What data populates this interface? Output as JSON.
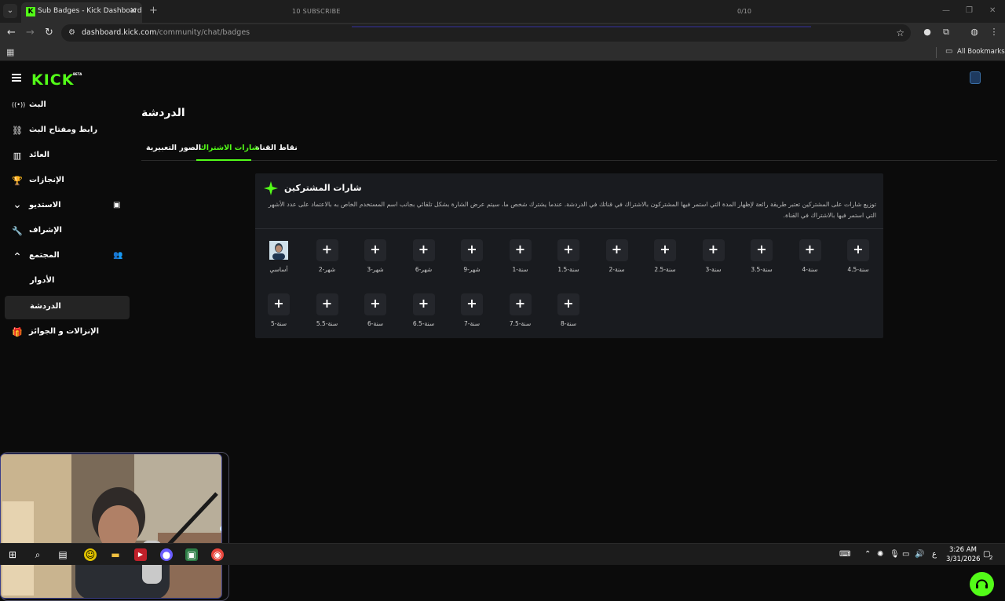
{
  "browser": {
    "tab_title": "Sub Badges - Kick Dashboard",
    "tab_favicon": "K",
    "new_tab_symbol": "+",
    "close_symbol": "✕",
    "url_domain": "dashboard.kick.com",
    "url_path": "/community/chat/badges",
    "bookmarks_label": "All Bookmarks"
  },
  "stream_overlay": {
    "subscribe_text": "10 SUBSCRIBE",
    "count_text": "0/10"
  },
  "app": {
    "logo": "KICK",
    "logo_badge": "BETA"
  },
  "sidebar": {
    "items": [
      {
        "label": "البث",
        "icon": "broadcast-icon",
        "glyph": "((•))"
      },
      {
        "label": "رابط ومفتاح البث",
        "icon": "link-icon",
        "glyph": "⛓"
      },
      {
        "label": "العائد",
        "icon": "revenue-chart-icon",
        "glyph": "▥"
      },
      {
        "label": "الإنجازات",
        "icon": "trophy-icon",
        "glyph": "🏆"
      },
      {
        "label": "الاستديو",
        "icon": "chevron-down-icon",
        "glyph": "⌄",
        "right_glyph": "▣"
      },
      {
        "label": "الإشراف",
        "icon": "wrench-icon",
        "glyph": "🔧"
      },
      {
        "label": "المجتمع",
        "icon": "chevron-up-icon",
        "glyph": "⌃",
        "right_glyph": "👥"
      },
      {
        "label": "الأدوار"
      },
      {
        "label": "الدردشة"
      },
      {
        "label": "الإنزالات و الجوائز",
        "icon": "gift-icon",
        "glyph": "🎁"
      }
    ]
  },
  "main": {
    "title": "الدردشة",
    "tabs": [
      "نقاط القناة",
      "شارات الاشتراك",
      "الصور التعبيرية"
    ]
  },
  "badges_card": {
    "title": "شارات المشتركين",
    "description": "توزيع شارات على المشتركين تعتبر طريقة رائعة لإظهار المدة التي استمر فيها المشتركون بالاشتراك في قناتك في الدردشة. عندما يشترك شخص ما، سيتم عرض الشارة بشكل تلقائي بجانب اسم المستخدم الخاص به بالاعتماد على عدد الأشهر التي استمر فيها بالاشتراك في القناة.",
    "add_symbol": "+",
    "slots": [
      {
        "label": "أساسي",
        "has_image": true
      },
      {
        "label": "2-شهر"
      },
      {
        "label": "3-شهر"
      },
      {
        "label": "6-شهر"
      },
      {
        "label": "9-شهر"
      },
      {
        "label": "1-سنة"
      },
      {
        "label": "1.5-سنة"
      },
      {
        "label": "2-سنة"
      },
      {
        "label": "2.5-سنة"
      },
      {
        "label": "3-سنة"
      },
      {
        "label": "3.5-سنة"
      },
      {
        "label": "4-سنة"
      },
      {
        "label": "4.5-سنة"
      },
      {
        "label": "5-سنة"
      },
      {
        "label": "5.5-سنة"
      },
      {
        "label": "6-سنة"
      },
      {
        "label": "6.5-سنة"
      },
      {
        "label": "7-سنة"
      },
      {
        "label": "7.5-سنة"
      },
      {
        "label": "8-سنة"
      }
    ]
  },
  "taskbar": {
    "time": "3:26 AM",
    "date": "3/31/2026",
    "lang": "ع",
    "notification_count": "2"
  },
  "colors": {
    "accent": "#53fc18",
    "background": "#0b0b0b",
    "card": "#191b1f"
  }
}
